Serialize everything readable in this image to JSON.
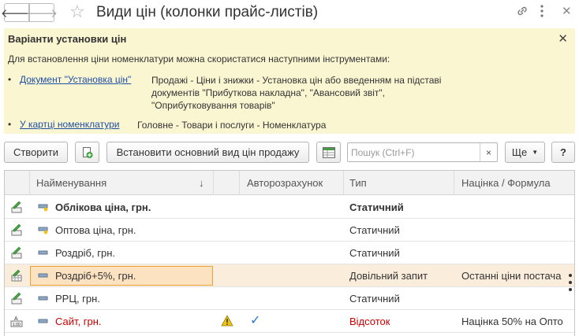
{
  "window": {
    "title": "Види цін (колонки прайс-листів)"
  },
  "info_panel": {
    "title": "Варіанти установки цін",
    "intro": "Для встановлення ціни номенклатури можна скористатися наступними інструментами:",
    "items": [
      {
        "bullet": "•",
        "link": "Документ \"Установка цін\"",
        "desc_lines": [
          "Продажі - Ціни і знижки - Установка цін або введенням на підставі",
          "документів \"Прибуткова накладна\", \"Авансовий звіт\",",
          "\"Оприбутковування товарів\""
        ]
      },
      {
        "bullet": "•",
        "link": "У картці номенклатури",
        "desc_lines": [
          "Головне - Товари і послуги - Номенклатура"
        ]
      }
    ]
  },
  "toolbar": {
    "create_label": "Створити",
    "set_main_label": "Встановити основний вид цін продажу",
    "search_placeholder": "Пошук (Ctrl+F)",
    "clear_label": "×",
    "more_label": "Ще",
    "help_label": "?"
  },
  "table": {
    "columns": [
      "Найменування",
      "Авторозрахунок",
      "Тип",
      "Націнка / Формула"
    ],
    "sort_indicator": "↓",
    "rows": [
      {
        "name": "Облікова ціна, грн.",
        "type": "Статичний",
        "formula": "",
        "bold": true,
        "auto": false,
        "warning": false,
        "red": false,
        "selected": false
      },
      {
        "name": "Оптова ціна, грн.",
        "type": "Статичний",
        "formula": "",
        "bold": false,
        "auto": false,
        "warning": false,
        "red": false,
        "selected": false
      },
      {
        "name": "Роздріб, грн.",
        "type": "Статичний",
        "formula": "",
        "bold": false,
        "auto": false,
        "warning": false,
        "red": false,
        "selected": false
      },
      {
        "name": "Роздріб+5%, грн.",
        "type": "Довільний запит",
        "formula": "Останні ціни постача",
        "bold": false,
        "auto": false,
        "warning": false,
        "red": false,
        "selected": true
      },
      {
        "name": "РРЦ, грн.",
        "type": "Статичний",
        "formula": "",
        "bold": false,
        "auto": false,
        "warning": false,
        "red": false,
        "selected": false
      },
      {
        "name": "Сайт, грн.",
        "type": "Відсоток",
        "formula": "Націнка 50% на Опто",
        "bold": false,
        "auto": true,
        "warning": true,
        "red": true,
        "selected": false
      }
    ]
  },
  "icons": {
    "back": "arrow-left-icon",
    "forward": "arrow-right-icon",
    "favorite": "star-icon",
    "link": "link-icon",
    "menu": "more-vertical-icon",
    "close": "close-icon"
  },
  "colors": {
    "info_bg": "#fbf6d2",
    "link": "#1f4fa3",
    "selected_row": "#fbeddb",
    "selected_cell_border": "#e8a23a",
    "red_text": "#cc0000",
    "check": "#2478c8"
  }
}
